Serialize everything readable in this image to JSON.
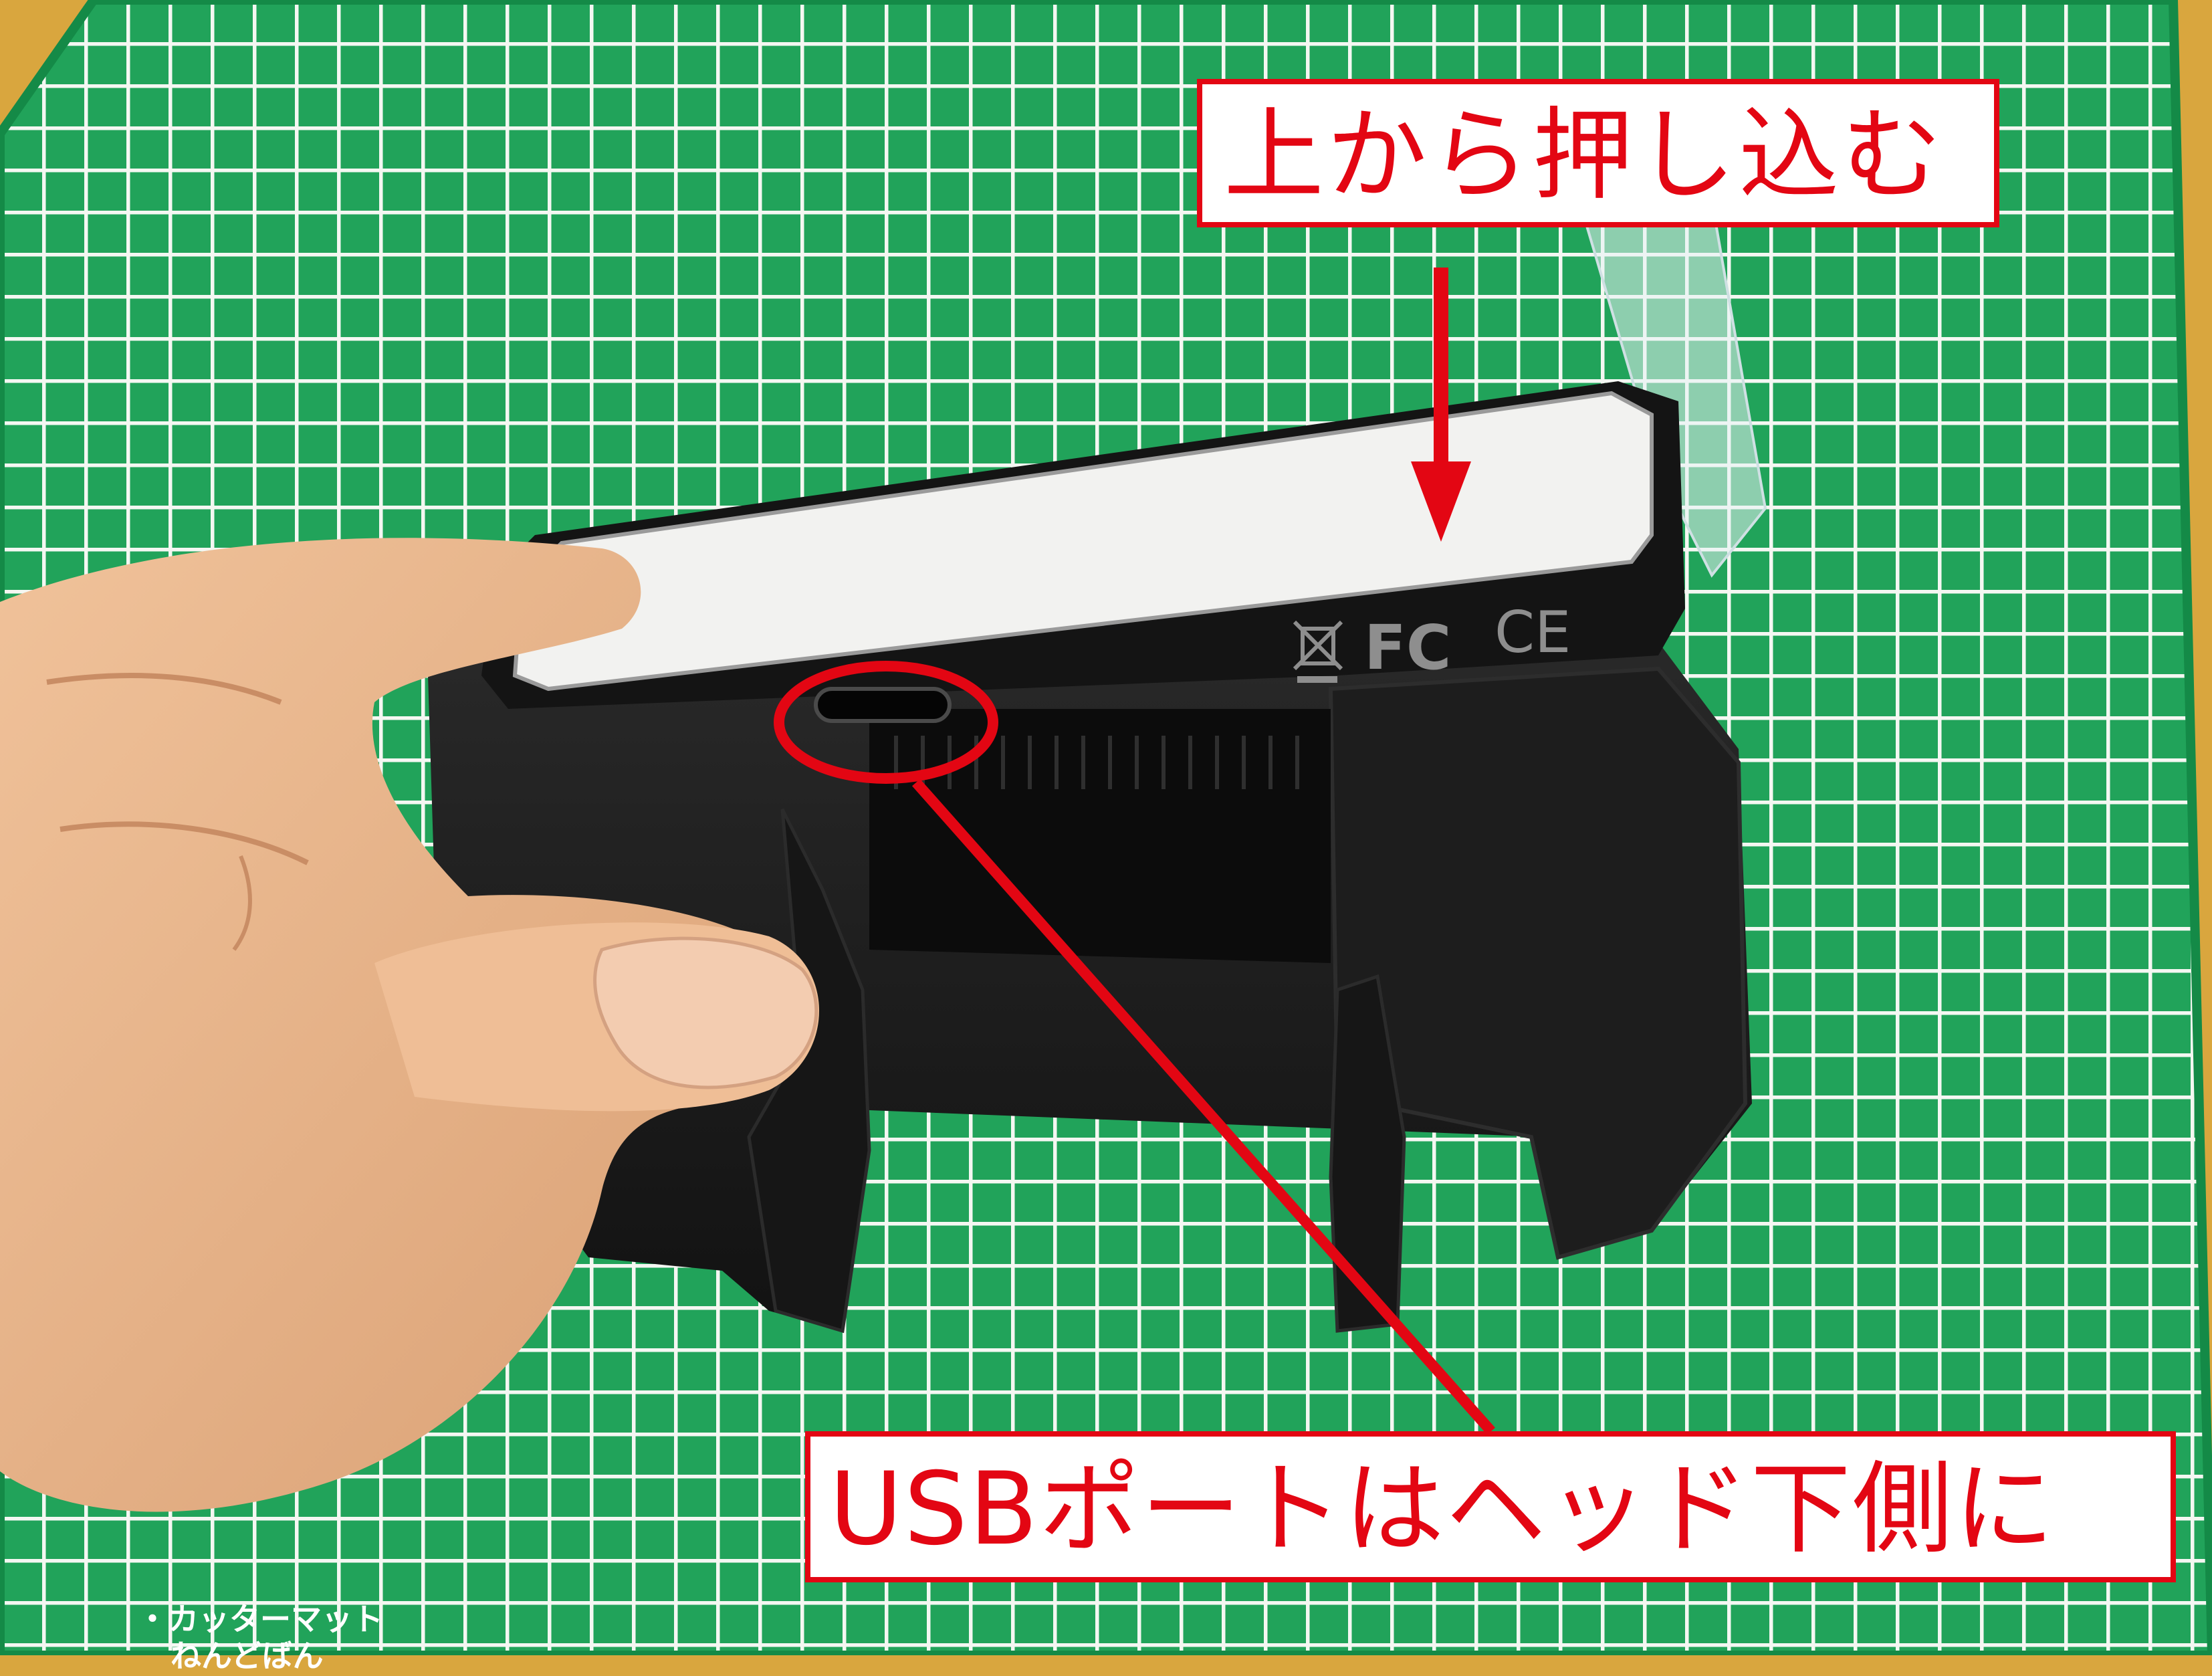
{
  "callouts": {
    "top": "上から押し込む",
    "bottom": "USBポートはヘッド下側に"
  },
  "device_marks": {
    "fcc": "FC",
    "ce": "CE"
  },
  "mat_print": {
    "line1": "・カッターマット",
    "line2": "ねんどばん"
  },
  "colors": {
    "annotation_red": "#e30613",
    "mat_green": "#21a35a",
    "grid_white": "#f4f7f2",
    "background_yellow": "#d9a63e",
    "printed_case": "#1b1b1b",
    "device_top": "#f2f2f0",
    "skin": "#e9b58c"
  }
}
